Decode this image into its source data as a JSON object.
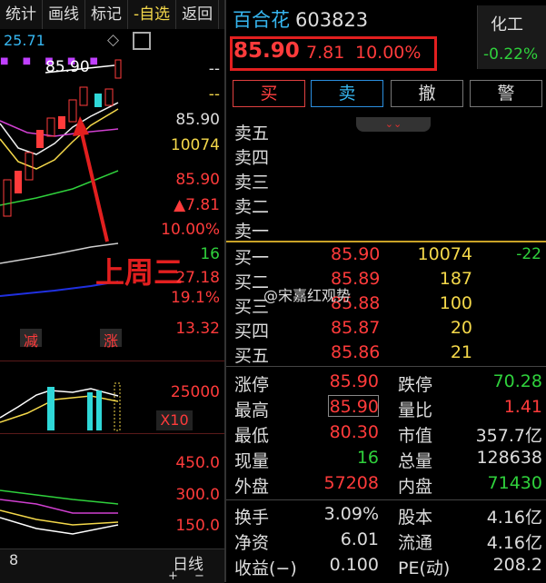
{
  "toolbar": {
    "items": [
      "统计",
      "画线",
      "标记",
      "-自选",
      "返回"
    ]
  },
  "chart_top": {
    "ma_value": "25.71",
    "high_label": "85.90",
    "dashes1": "--",
    "dashes2": "--"
  },
  "left_axis": {
    "price_now": "85.90",
    "vol": "10074",
    "price2": "85.90",
    "chg": "▲7.81",
    "pct": "10.00%",
    "v16": "16",
    "v2718": "27.18",
    "pct191": "19.1%",
    "v1332": "13.32",
    "v25000": "25000",
    "x10": "X10",
    "v4500": "450.0",
    "v3000": "300.0",
    "v1500": "150.0"
  },
  "tags": {
    "jianchi": "减",
    "zhang": "涨"
  },
  "annotation": "上周三",
  "bottom": {
    "date": "8",
    "period": "日线",
    "plus": "+",
    "minus": "−"
  },
  "header": {
    "name": "百合花",
    "code": "603823",
    "price": "85.90",
    "change": "7.81",
    "pct": "10.00%",
    "sector": "化工",
    "sector_change": "-0.22%"
  },
  "buttons": {
    "buy": "买",
    "sell": "卖",
    "cancel": "撤",
    "warn": "警"
  },
  "sell_levels": [
    "卖五",
    "卖四",
    "卖三",
    "卖二",
    "卖一"
  ],
  "buy_levels": [
    {
      "label": "买一",
      "price": "85.90",
      "vol": "10074",
      "chg": "-22"
    },
    {
      "label": "买二",
      "price": "85.89",
      "vol": "187",
      "chg": ""
    },
    {
      "label": "买三",
      "price": "85.88",
      "vol": "100",
      "chg": ""
    },
    {
      "label": "买四",
      "price": "85.87",
      "vol": "20",
      "chg": ""
    },
    {
      "label": "买五",
      "price": "85.86",
      "vol": "21",
      "chg": ""
    }
  ],
  "watermark": "@宋嘉红观势",
  "stats": [
    {
      "l1": "涨停",
      "v1": "85.90",
      "c1": "red",
      "l2": "跌停",
      "v2": "70.28",
      "c2": "green"
    },
    {
      "l1": "最高",
      "v1": "85.90",
      "c1": "red",
      "l2": "量比",
      "v2": "1.41",
      "c2": "red"
    },
    {
      "l1": "最低",
      "v1": "80.30",
      "c1": "red",
      "l2": "市值",
      "v2": "357.7亿",
      "c2": "white"
    },
    {
      "l1": "现量",
      "v1": "16",
      "c1": "green",
      "l2": "总量",
      "v2": "128638",
      "c2": "white"
    },
    {
      "l1": "外盘",
      "v1": "57208",
      "c1": "red",
      "l2": "内盘",
      "v2": "71430",
      "c2": "green"
    }
  ],
  "stats2": [
    {
      "l1": "换手",
      "v1": "3.09%",
      "l2": "股本",
      "v2": "4.16亿"
    },
    {
      "l1": "净资",
      "v1": "6.01",
      "l2": "流通",
      "v2": "4.16亿"
    },
    {
      "l1": "收益(−)",
      "v1": "0.100",
      "l2": "PE(动)",
      "v2": "208.2"
    }
  ],
  "colors": {
    "up": "#ff3b3b",
    "down": "#2fd13c",
    "accent": "#36b6f0",
    "highlight": "#e21f1f"
  }
}
